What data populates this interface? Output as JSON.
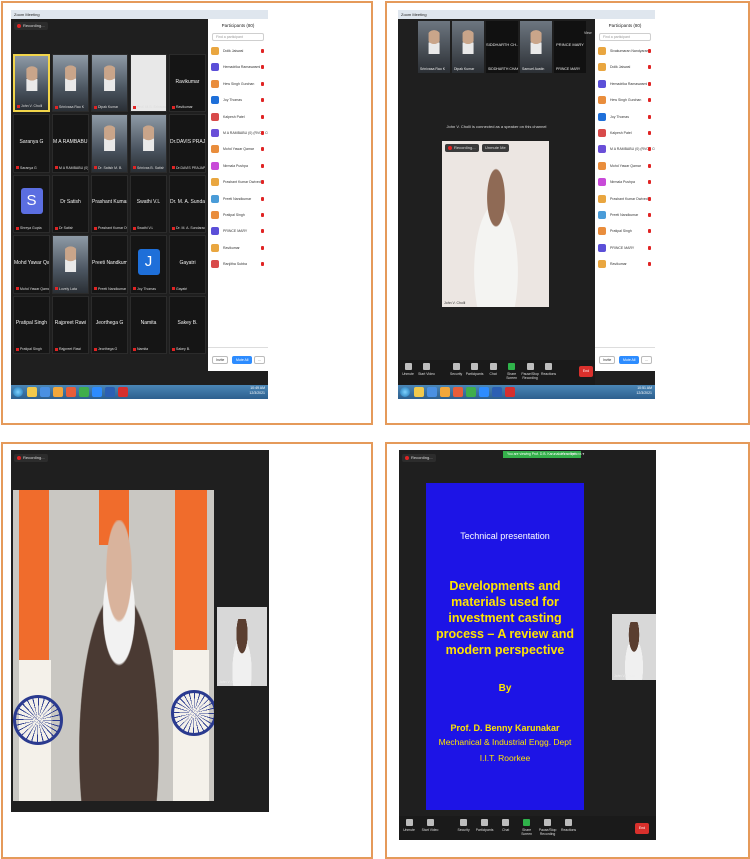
{
  "panel1": {
    "title": "Zoom Meeting",
    "recording": "Recording...",
    "tiles": [
      {
        "big": "",
        "small": "John V. Cholli",
        "kind": "photo",
        "active": true
      },
      {
        "big": "",
        "small": "Srinivasa Rao K",
        "kind": "photo"
      },
      {
        "big": "",
        "small": "Dipak Kumar",
        "kind": "photo"
      },
      {
        "big": "",
        "small": "Prof. M.S. Srinivasa Rao",
        "kind": "logo"
      },
      {
        "big": "Ravikumar",
        "small": "Ravikumar",
        "kind": "name"
      },
      {
        "big": "Saranya G",
        "small": "Saranya G",
        "kind": "name"
      },
      {
        "big": "M A RAMBABU (...",
        "small": "M A RAMBABU (0) (RVCE COLL...",
        "kind": "name"
      },
      {
        "big": "",
        "small": "Dr. Satish M. B.",
        "kind": "photo"
      },
      {
        "big": "",
        "small": "Srinivas B. Satish",
        "kind": "photo"
      },
      {
        "big": "Dr.DAVIS PRAJ...",
        "small": "Dr.DAVIS PRAJAPATI",
        "kind": "name"
      },
      {
        "big": "S",
        "small": "Shreya Gupta",
        "kind": "avatar",
        "color": "#5b6ee1"
      },
      {
        "big": "Dr Satish",
        "small": "Dr Satish",
        "kind": "name"
      },
      {
        "big": "Prashant Kumar...",
        "small": "Prashant Kumar Dwivedi",
        "kind": "name"
      },
      {
        "big": "Swathi V.L",
        "small": "Swathi V.L",
        "kind": "name"
      },
      {
        "big": "Dr. M. A. Sunda...",
        "small": "Dr. M. A. Sundaradaran",
        "kind": "name"
      },
      {
        "big": "Mohd Yawar Qa...",
        "small": "Mohd Yawar Qamar",
        "kind": "name"
      },
      {
        "big": "",
        "small": "Lovely Lata",
        "kind": "photo"
      },
      {
        "big": "Preeti Nandkum...",
        "small": "Preeti Nandkumar",
        "kind": "name"
      },
      {
        "big": "J",
        "small": "Joy Thomas",
        "kind": "avatar",
        "color": "#1e6fd9"
      },
      {
        "big": "Gayatri",
        "small": "Gayatri",
        "kind": "name"
      },
      {
        "big": "Pratipal Singh",
        "small": "Pratipal Singh",
        "kind": "name"
      },
      {
        "big": "Rajpreet Rawi",
        "small": "Rajpreet Rawi",
        "kind": "name"
      },
      {
        "big": "Jeorthega G",
        "small": "Jeorthega G",
        "kind": "name"
      },
      {
        "big": "Namita",
        "small": "Namita",
        "kind": "name"
      },
      {
        "big": "Sakey B.",
        "small": "Sakey B.",
        "kind": "name"
      }
    ],
    "participants_title": "Participants (80)",
    "search_placeholder": "Find a participant",
    "participants": [
      {
        "name": "Dolik Jaiswal",
        "color": "#e9a640"
      },
      {
        "name": "Hemadrika Ramaswami",
        "color": "#5b4fd8"
      },
      {
        "name": "Hew Singh Gurchan",
        "color": "#e98d3c"
      },
      {
        "name": "Joy Thomas",
        "color": "#1e6fd9"
      },
      {
        "name": "Kalpesh Patel",
        "color": "#d84a4a"
      },
      {
        "name": "M A RAMBABU (0) (RVCE COLL...",
        "color": "#6a4fd8"
      },
      {
        "name": "Mohd Yawar Qamar",
        "color": "#e98d3c"
      },
      {
        "name": "Nirmala Pushpa",
        "color": "#c84ad8"
      },
      {
        "name": "Prashant Kumar Dwivedi",
        "color": "#e9a640"
      },
      {
        "name": "Preeti Nandkumar",
        "color": "#4a9cd8"
      },
      {
        "name": "Pratipal Singh",
        "color": "#e98d3c"
      },
      {
        "name": "PRINCE MARY",
        "color": "#5b4fd8"
      },
      {
        "name": "Ravikumar",
        "color": "#e9a640"
      },
      {
        "name": "Ranjitha Subba",
        "color": "#d84a4a"
      }
    ],
    "invite_label": "Invite",
    "mute_all_label": "Mute All",
    "more_label": "...",
    "clock_time": "10:49 AM",
    "clock_date": "12/3/2021"
  },
  "panel2": {
    "title": "Zoom Meeting",
    "strip": [
      {
        "label": "Srinivasa Rao K",
        "kind": "photo"
      },
      {
        "label": "Dipak Kumar",
        "kind": "photo"
      },
      {
        "label": "SIDDHARTH CH...",
        "kind": "name",
        "small": "SIDDHARTH CHAKRA..."
      },
      {
        "label": "Samuel Austin",
        "kind": "photo"
      },
      {
        "label": "PRINCE MARY",
        "kind": "name",
        "small": "PRINCE MARY"
      }
    ],
    "view_label": "View",
    "speaking_text": "John V. Cholli is connected as a speaker on this channel",
    "inner_recording": "Recording...",
    "inner_unmute": "Unmute Me",
    "speaker_label": "John V. Cholli",
    "participants_title": "Participants (80)",
    "search_placeholder": "Find a participant",
    "participants": [
      {
        "name": "Sivakumaran Nandyaram",
        "color": "#e9a640"
      },
      {
        "name": "Dolik Jaiswal",
        "color": "#e9a640"
      },
      {
        "name": "Hemadrika Ramaswami",
        "color": "#5b4fd8"
      },
      {
        "name": "Hew Singh Gurchan",
        "color": "#e98d3c"
      },
      {
        "name": "Joy Thomas",
        "color": "#1e6fd9"
      },
      {
        "name": "Kalpesh Patel",
        "color": "#d84a4a"
      },
      {
        "name": "M A RAMBABU (0) (RVCE COLL...",
        "color": "#6a4fd8"
      },
      {
        "name": "Mohd Yawar Qamar",
        "color": "#e98d3c"
      },
      {
        "name": "Nirmala Pushpa",
        "color": "#c84ad8"
      },
      {
        "name": "Prashant Kumar Dwivedi",
        "color": "#e9a640"
      },
      {
        "name": "Preeti Nandkumar",
        "color": "#4a9cd8"
      },
      {
        "name": "Pratipal Singh",
        "color": "#e98d3c"
      },
      {
        "name": "PRINCE MARY",
        "color": "#5b4fd8"
      },
      {
        "name": "Ravikumar",
        "color": "#e9a640"
      }
    ],
    "invite_label": "Invite",
    "mute_all_label": "Mute All",
    "more_label": "...",
    "toolbar": [
      "Unmute",
      "Start Video",
      "Security",
      "Participants",
      "Chat",
      "Share Screen",
      "Pause/Stop Recording",
      "Reactions"
    ],
    "end_label": "End",
    "clock_time": "10:51 AM",
    "clock_date": "12/3/2021"
  },
  "panel3": {
    "recording": "Recording...",
    "pip_label": "John V. Cholli"
  },
  "panel4": {
    "recording": "Recording...",
    "share_banner": "You are viewing Prof. D.B. Karunakar's screen",
    "view_options": "View Options ▾",
    "slide": {
      "line1": "Technical presentation",
      "line2": "Developments and materials used for investment casting process – A review and modern perspective",
      "line3": "By",
      "line4": "Prof. D. Benny Karunakar",
      "line5": "Mechanical & Industrial Engg. Dept",
      "line6": "I.I.T. Roorkee"
    },
    "pip_label": "John V. Cholli",
    "toolbar": [
      "Unmute",
      "Start Video",
      "Security",
      "Participants",
      "Chat",
      "Share Screen",
      "Pause/Stop Recording",
      "Reactions"
    ],
    "end_label": "End"
  },
  "colors": {
    "frame": "#e59a5a",
    "slide_bg": "#1d14e6",
    "slide_text": "#ffe400",
    "zoom_blue": "#2d8cff",
    "end_red": "#d9302c"
  }
}
